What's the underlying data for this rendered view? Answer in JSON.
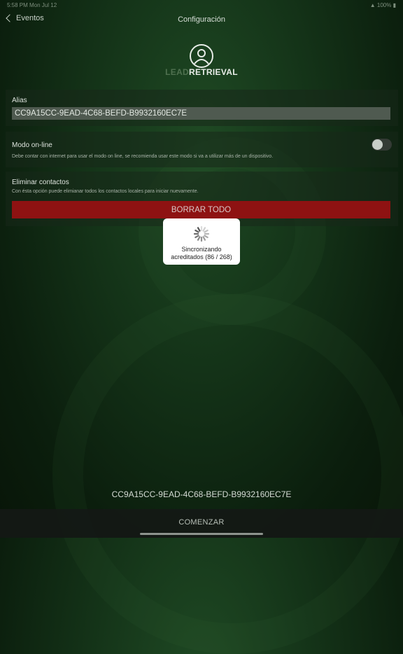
{
  "status_bar": {
    "time": "5:58 PM  Mon Jul 12",
    "battery": "▲ 100% ▮"
  },
  "nav": {
    "back_label": "Eventos",
    "title": "Configuración"
  },
  "logo": {
    "lead": "LEAD",
    "retrieval": "RETRIEVAL"
  },
  "alias": {
    "label": "Alias",
    "value": "CC9A15CC-9EAD-4C68-BEFD-B9932160EC7E"
  },
  "online_mode": {
    "label": "Modo on-line",
    "description": "Debe contar con internet para usar el modo on line, se recomienda usar este modo si va a utilizar más de un dispositivo.",
    "enabled": false
  },
  "delete_contacts": {
    "label": "Eliminar contactos",
    "description": "Con ésta opción puede elimianar todos los contactos locales para iniciar nuevamente.",
    "button_label": "BORRAR TODO",
    "button_color": "#8e1212"
  },
  "sync_hud": {
    "line1": "Sincronizando",
    "line2": "acreditados (86 / 268)"
  },
  "device_id": "CC9A15CC-9EAD-4C68-BEFD-B9932160EC7E",
  "footer": {
    "start_label": "COMENZAR"
  }
}
